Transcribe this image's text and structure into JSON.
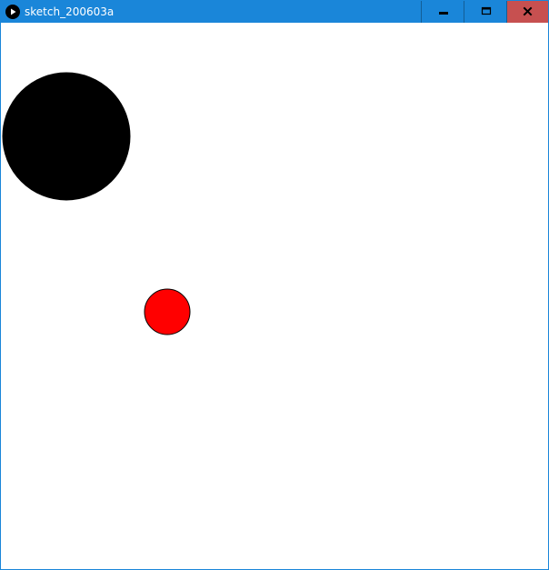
{
  "window": {
    "title": "sketch_200603a",
    "title_bar_color": "#1a86d9",
    "close_button_color": "#c75050",
    "icons": {
      "app": "processing-play-icon",
      "minimize": "minimize-icon",
      "maximize": "maximize-icon",
      "close": "close-icon"
    }
  },
  "sketch": {
    "background_color": "#ffffff",
    "shapes": [
      {
        "name": "black-circle",
        "fill": "#000000",
        "stroke": "#000000"
      },
      {
        "name": "red-circle",
        "fill": "#ff0000",
        "stroke": "#000000"
      }
    ]
  }
}
